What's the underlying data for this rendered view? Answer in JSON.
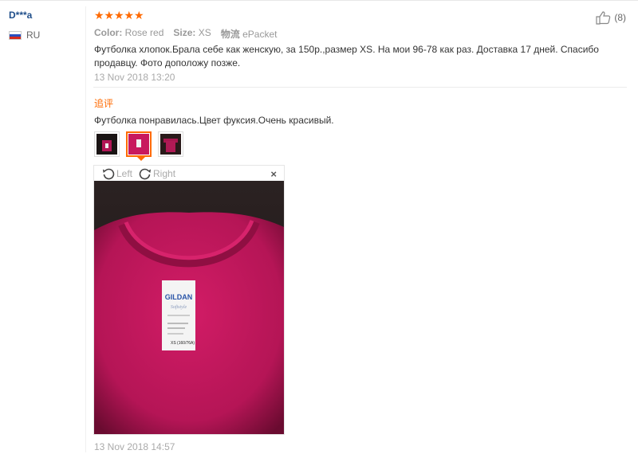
{
  "review": {
    "user": {
      "name": "D***a",
      "country": "RU"
    },
    "rating": 5,
    "helpful_count": "(8)",
    "meta": {
      "color_label": "Color:",
      "color_value": "Rose red",
      "size_label": "Size:",
      "size_value": "XS",
      "shipping_label": "物流",
      "shipping_value": "ePacket"
    },
    "text": "Футболка хлопок.Брала себе как женскую, за 150р.,размер XS. На мои 96-78 как раз. Доставка 17 дней. Спасибо продавцу. Фото доположу позже.",
    "date": "13 Nov 2018 13:20",
    "additional": {
      "title": "追评",
      "text": "Футболка понравилась.Цвет фуксия.Очень красивый.",
      "thumbnails": [
        {
          "name": "photo-1",
          "active": false
        },
        {
          "name": "photo-2",
          "active": true
        },
        {
          "name": "photo-3",
          "active": false
        }
      ],
      "viewer": {
        "left_label": "Left",
        "right_label": "Right",
        "close_glyph": "×"
      },
      "label_text": {
        "brand": "GILDAN",
        "line": "Softstyle",
        "size": "XS (160/76A)"
      },
      "date": "13 Nov 2018 14:57"
    }
  },
  "colors": {
    "accent": "#ff6a00",
    "username": "#1f4e8a",
    "shirt": "#c8195e"
  },
  "icons": {
    "helpful": "thumbs-up-icon",
    "rotate_left": "rotate-left-icon",
    "rotate_right": "rotate-right-icon",
    "close": "close-icon",
    "flag": "russia-flag-icon",
    "star": "star-icon"
  }
}
